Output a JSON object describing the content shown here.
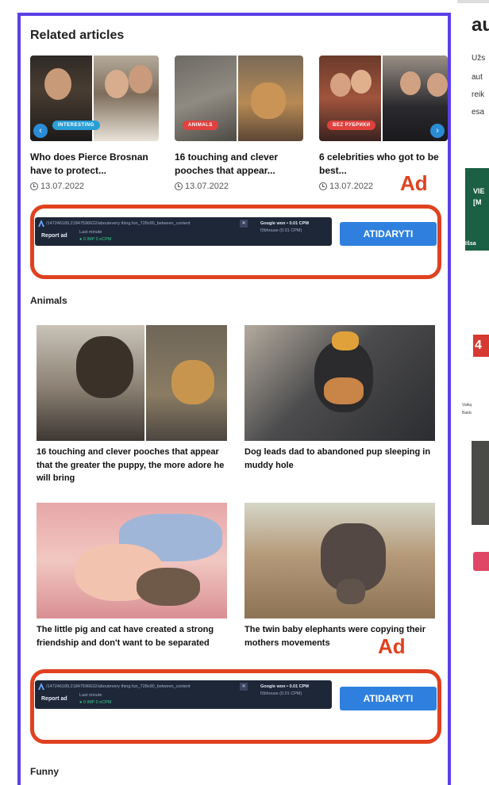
{
  "related": {
    "heading": "Related articles",
    "cards": [
      {
        "title": "Who does Pierce Brosnan have to protect...",
        "date": "13.07.2022",
        "badge": "INTERESTING",
        "badge_color": "#2a9fd6"
      },
      {
        "title": "16 touching and clever pooches that appear...",
        "date": "13.07.2022",
        "badge": "ANIMALS",
        "badge_color": "#e0413f"
      },
      {
        "title": "6 celebrities who got to be best...",
        "date": "13.07.2022",
        "badge": "BEZ РУБРИКИ",
        "badge_color": "#e0413f"
      }
    ]
  },
  "ad_annotations": [
    {
      "label": "Ad"
    },
    {
      "label": "Ad"
    }
  ],
  "ad_bar": {
    "path": "/147246189,21847596622/aboutevery thing.fun_728x90_between_content",
    "close": "✕",
    "report": "Report ad",
    "last_minute": "Last minute",
    "stats": "● 0 IMP 0 eCPM",
    "won": "Google won • 0.01 CPM",
    "bhouse": "f3bhouse (0.01 CPM)",
    "open_button": "ATIDARYTI"
  },
  "animals": {
    "heading": "Animals",
    "items": [
      {
        "title": "16 touching and clever pooches that appear that the greater the puppy, the more adore he will bring"
      },
      {
        "title": "Dog leads dad to abandoned pup sleeping in muddy hole"
      },
      {
        "title": "The little pig and cat have created a strong friendship and don't want to be separated"
      },
      {
        "title": "The twin baby elephants were copying their mothers movements"
      }
    ]
  },
  "funny": {
    "heading": "Funny"
  },
  "sidebar": {
    "title": "au",
    "lines": [
      "Užs",
      "aut",
      "reik",
      "esa"
    ],
    "dark_lines": [
      "VIE",
      "[M",
      "Išsa"
    ],
    "red_logo": "4",
    "small_lines": [
      "Vaiką",
      "Baidc"
    ]
  },
  "colors": {
    "frame": "#5b3fe6",
    "ad_annotation": "#e0411f",
    "button": "#2f80de"
  }
}
